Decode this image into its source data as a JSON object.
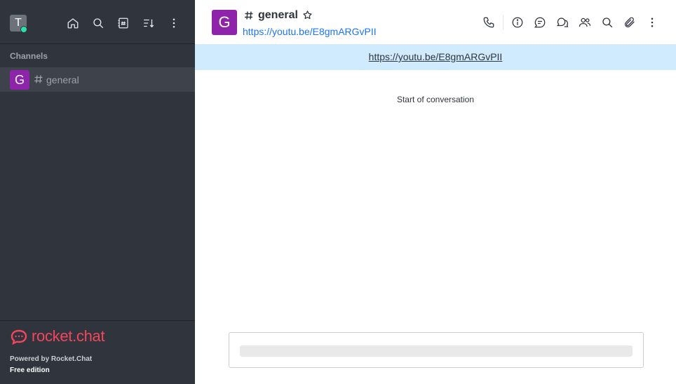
{
  "user": {
    "avatar_letter": "T",
    "status_color": "#2de0a5"
  },
  "sidebar": {
    "icons": [
      "home-icon",
      "search-icon",
      "directory-icon",
      "sort-icon",
      "kebab-menu-icon"
    ],
    "section_title": "Channels",
    "channels": [
      {
        "avatar_letter": "G",
        "name": "general",
        "avatar_color": "#8e24aa"
      }
    ],
    "footer": {
      "brand": "rocket.chat",
      "powered_by": "Powered by Rocket.Chat",
      "edition": "Free edition",
      "brand_color": "#f5455c"
    }
  },
  "room": {
    "avatar_letter": "G",
    "name": "general",
    "topic": "https://youtu.be/E8gmARGvPII",
    "announcement": "https://youtu.be/E8gmARGvPII",
    "start_text": "Start of conversation",
    "header_icons": [
      "call-icon",
      "info-icon",
      "threads-icon",
      "discussions-icon",
      "members-icon",
      "search-icon",
      "attachment-icon",
      "kebab-menu-icon"
    ]
  },
  "colors": {
    "sidebar_bg": "#2f343d",
    "link": "#1d74f5",
    "announcement_bg": "#d1ebfe"
  }
}
